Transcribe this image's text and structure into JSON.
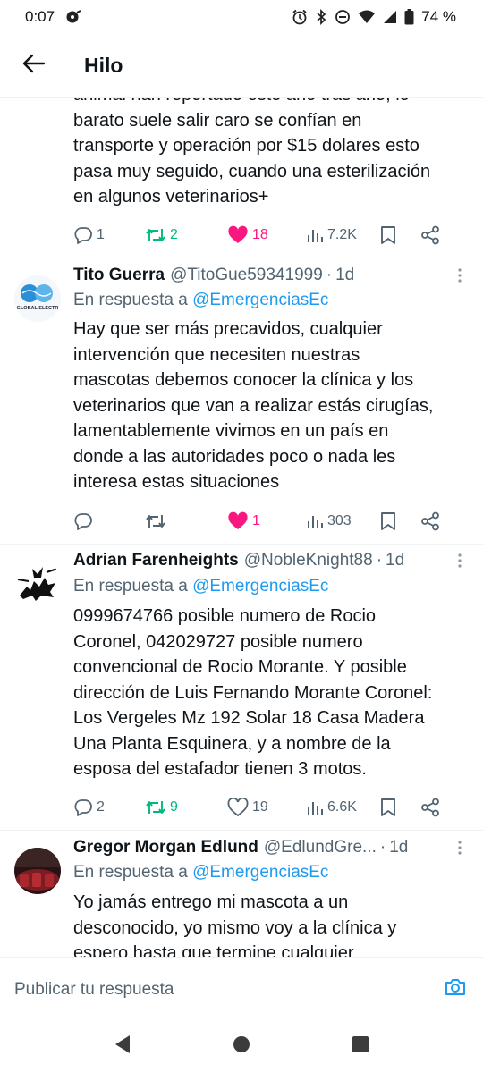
{
  "status_bar": {
    "time": "0:07",
    "battery": "74 %"
  },
  "header": {
    "title": "Hilo"
  },
  "partial_tweet": {
    "lines": [
      "animal han reportado esto año tras año, lo",
      "barato suele salir caro se confían en",
      "transporte y operación por $15 dolares esto",
      "pasa muy seguido, cuando una esterilización",
      "en algunos veterinarios+"
    ],
    "replies": "1",
    "retweets": "2",
    "likes": "18",
    "views": "7.2K"
  },
  "tweets": [
    {
      "name": "Tito Guerra",
      "handle": "@TitoGue59341999",
      "time": "1d",
      "reply_prefix": "En respuesta a ",
      "reply_to": "@EmergenciasEc",
      "lines": [
        "Hay que ser más precavidos, cualquier",
        "intervención que necesiten nuestras",
        "mascotas debemos conocer la clínica y los",
        "veterinarios que van a realizar estás cirugías,",
        "lamentablemente vivimos en un país en",
        "donde a las autoridades poco o nada les",
        "interesa estas situaciones"
      ],
      "replies": "",
      "retweets": "",
      "likes": "1",
      "views": "303",
      "avatar_text": "GLOBAL ELECTR"
    },
    {
      "name": "Adrian Farenheights",
      "handle": "@NobleKnight88",
      "time": "1d",
      "reply_prefix": "En respuesta a ",
      "reply_to": "@EmergenciasEc",
      "lines": [
        "0999674766 posible numero de Rocio",
        "Coronel, 042029727 posible numero",
        "convencional de Rocio Morante. Y posible",
        "dirección de Luis Fernando Morante Coronel:",
        "Los Vergeles Mz 192 Solar 18 Casa Madera",
        "Una Planta Esquinera, y a nombre de la",
        "esposa del estafador tienen 3 motos."
      ],
      "replies": "2",
      "retweets": "9",
      "likes": "19",
      "views": "6.6K"
    },
    {
      "name": "Gregor Morgan Edlund",
      "handle": "@EdlundGre...",
      "time": "1d",
      "reply_prefix": "En respuesta a ",
      "reply_to": "@EmergenciasEc",
      "lines": [
        "Yo jamás entrego mi mascota a un",
        "desconocido, yo mismo voy a la clínica y",
        "espero hasta que termine cualquier"
      ]
    }
  ],
  "compose": {
    "placeholder": "Publicar tu respuesta"
  },
  "icons": {
    "back": "arrow-left-icon",
    "reply": "reply-icon",
    "retweet": "retweet-icon",
    "like": "heart-icon",
    "views": "views-icon",
    "bookmark": "bookmark-icon",
    "share": "share-icon",
    "more": "more-vertical-icon",
    "camera": "camera-icon"
  },
  "colors": {
    "accent": "#1d9bf0",
    "retweet": "#00ba7c",
    "like": "#f91880",
    "muted": "#536471"
  }
}
